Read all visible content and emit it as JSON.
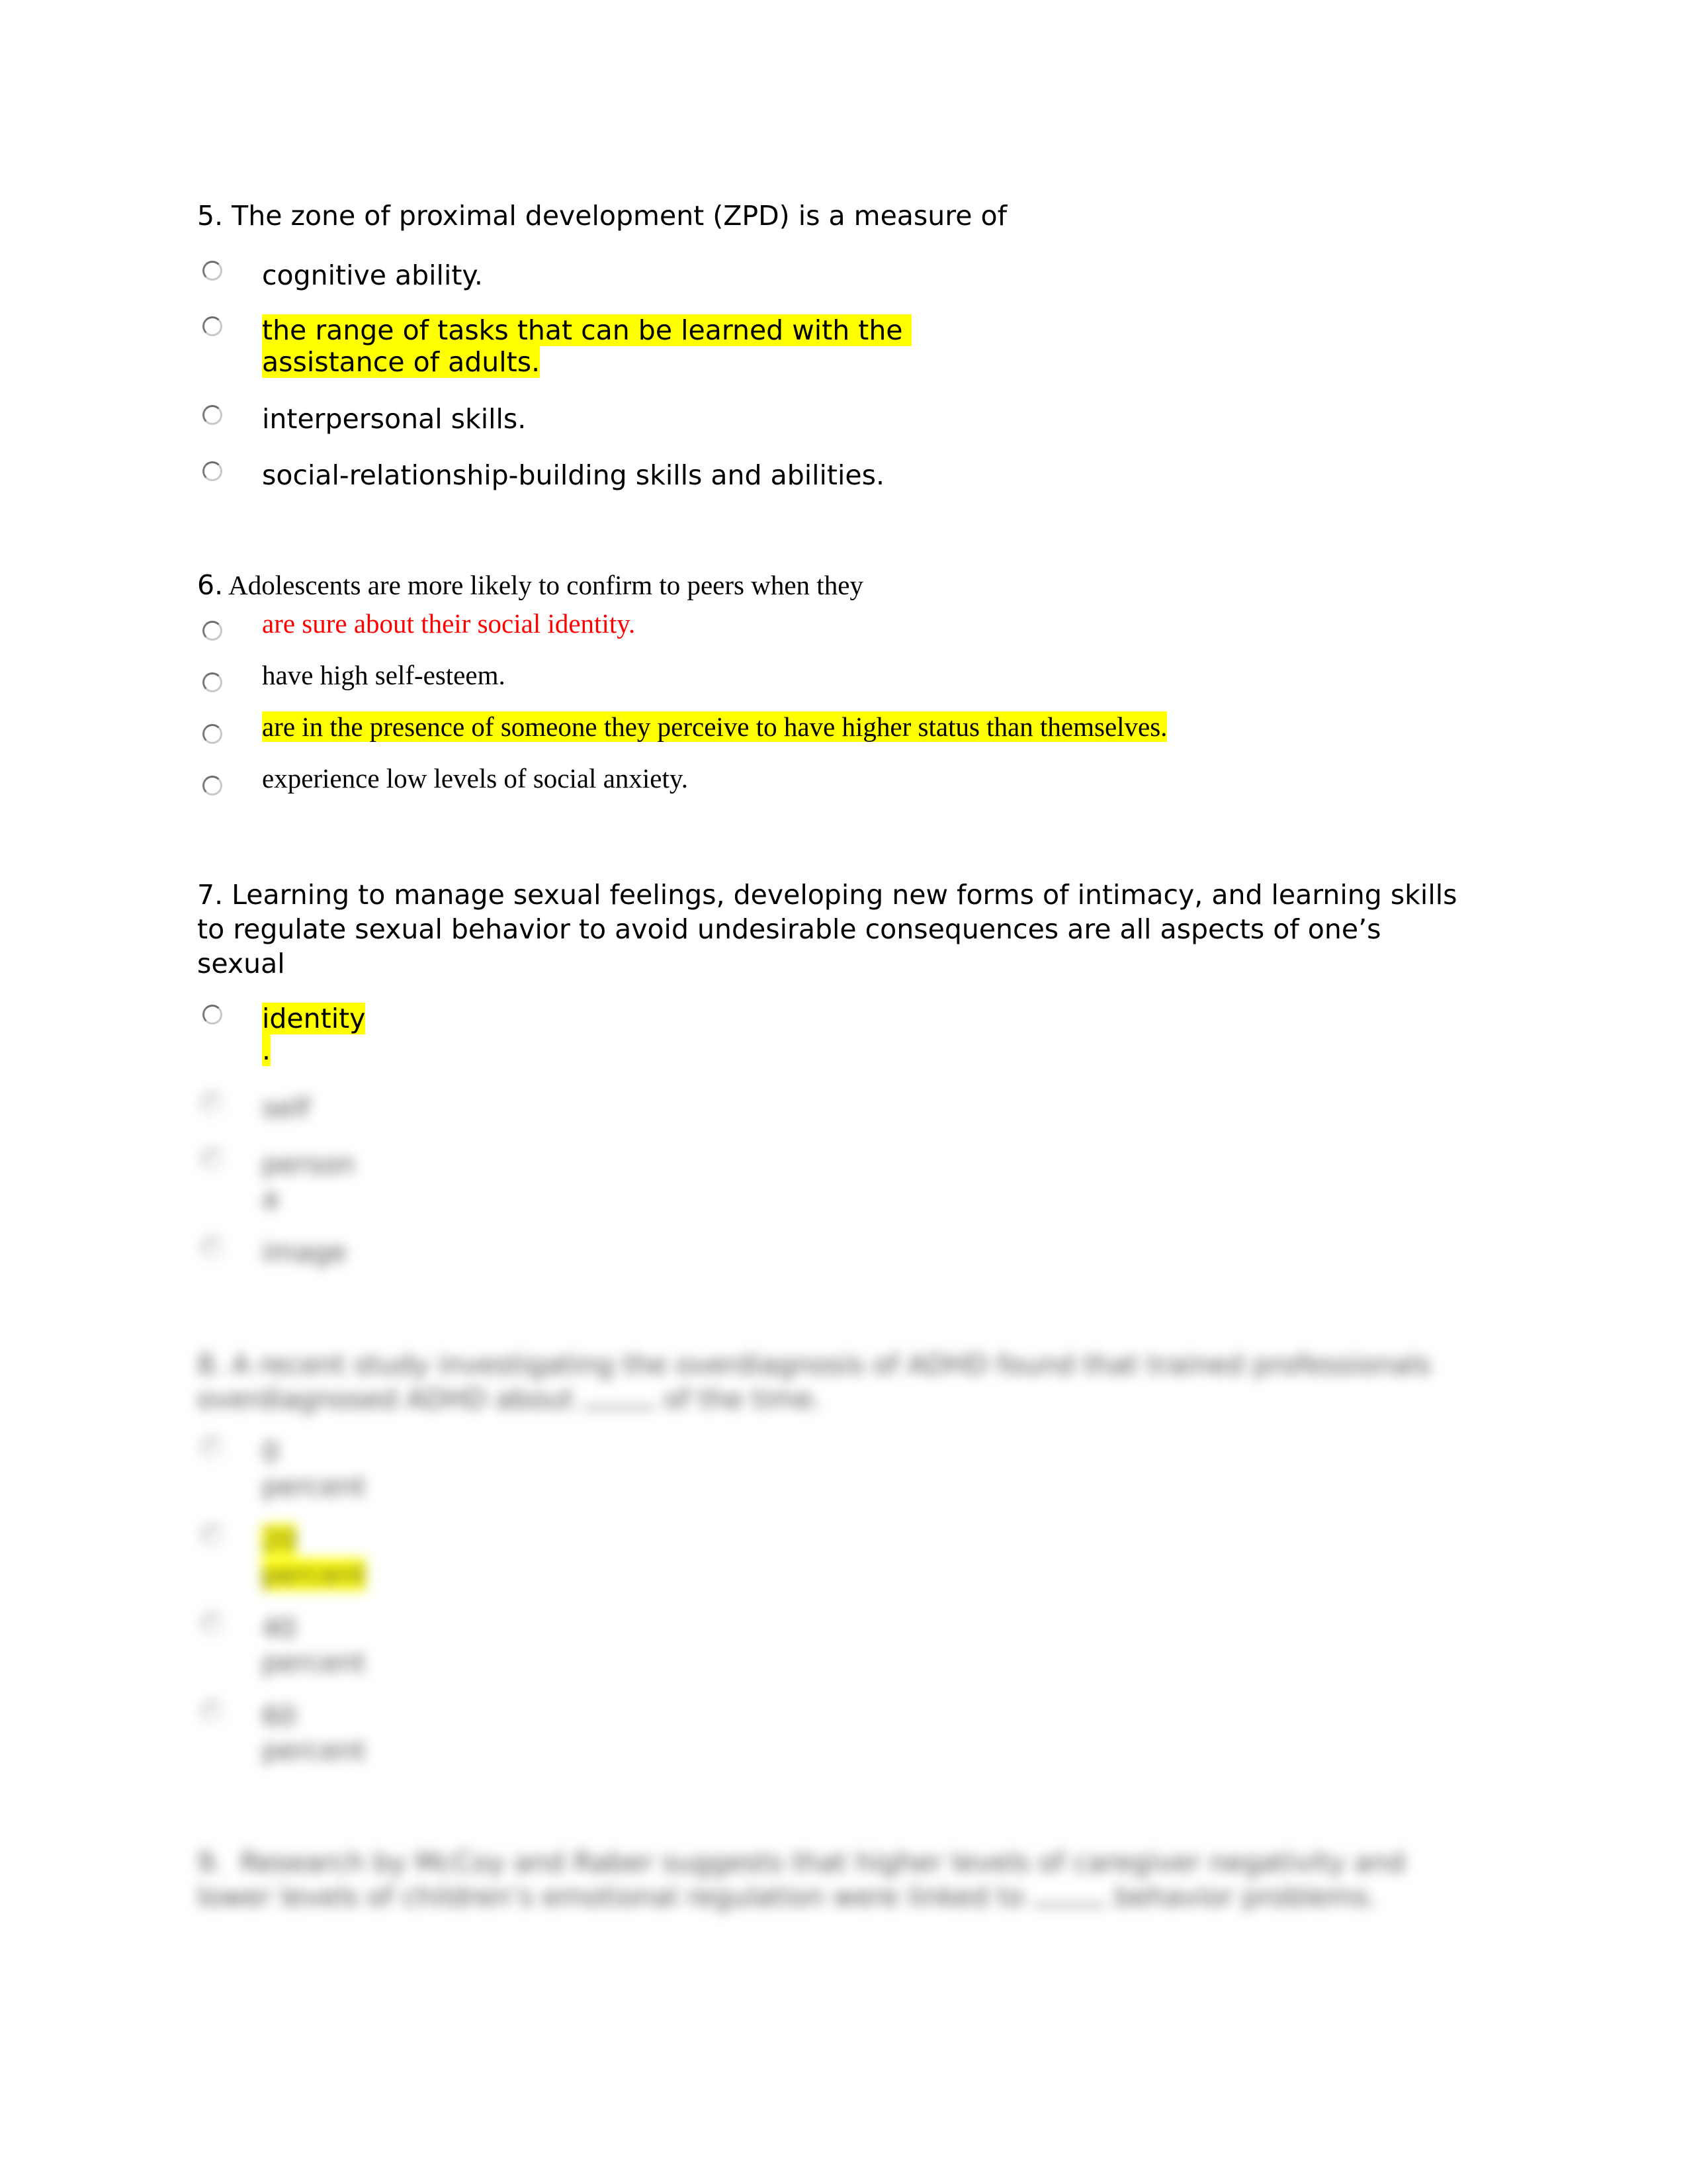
{
  "questions": [
    {
      "number": "5.",
      "text": " The zone of proximal development (ZPD) is a measure of",
      "options": [
        {
          "label": "cognitive ability.",
          "highlighted": false
        },
        {
          "label_lines": [
            "the range of tasks that can be learned with the ",
            "assistance of adults."
          ],
          "highlighted": true
        },
        {
          "label": "interpersonal skills.",
          "highlighted": false
        },
        {
          "label": "social-relationship-building skills and abilities.",
          "highlighted": false
        }
      ]
    },
    {
      "number": "6.",
      "text": " Adolescents are more likely to confirm to peers when they",
      "options": [
        {
          "label": "are sure about their social identity.",
          "color": "#ff0000"
        },
        {
          "label": "have high self-esteem."
        },
        {
          "label": "are in the presence of someone they perceive to have higher status than themselves.",
          "highlighted": true
        },
        {
          "label": "experience low levels of social anxiety."
        }
      ]
    },
    {
      "number": "7.",
      "text_lines": [
        "7. Learning to manage sexual feelings, developing new forms of intimacy, and learning skills",
        "to regulate sexual behavior to avoid undesirable consequences are all aspects of one’s",
        "sexual"
      ],
      "options": [
        {
          "label_lines": [
            "identity",
            "."
          ],
          "highlighted": true
        },
        {
          "label": "self",
          "blurred": true
        },
        {
          "label_lines": [
            "person",
            "a"
          ],
          "blurred": true
        },
        {
          "label": "image",
          "blurred": true
        }
      ]
    },
    {
      "number": "8.",
      "blurred": true,
      "text_lines": [
        "8. A recent study investigating the overdiagnosis of ADHD found that trained professionals",
        "overdiagnosed ADHD about",
        "of the time."
      ],
      "options": [
        {
          "label_lines": [
            "0",
            "percent"
          ]
        },
        {
          "label_lines": [
            "20",
            "percent"
          ],
          "highlighted": true
        },
        {
          "label_lines": [
            "40",
            "percent"
          ]
        },
        {
          "label_lines": [
            "60",
            "percent"
          ]
        }
      ]
    },
    {
      "number": "9.",
      "blurred": true,
      "text_lines": [
        "9.  Research by McCoy and Raber suggests that higher levels of caregiver negativity and",
        "lower levels of children’s emotional regulation were linked to",
        "behavior problems."
      ]
    }
  ],
  "colors": {
    "highlight": "#ffff00",
    "incorrect_text": "#ff0000",
    "text": "#000000"
  }
}
